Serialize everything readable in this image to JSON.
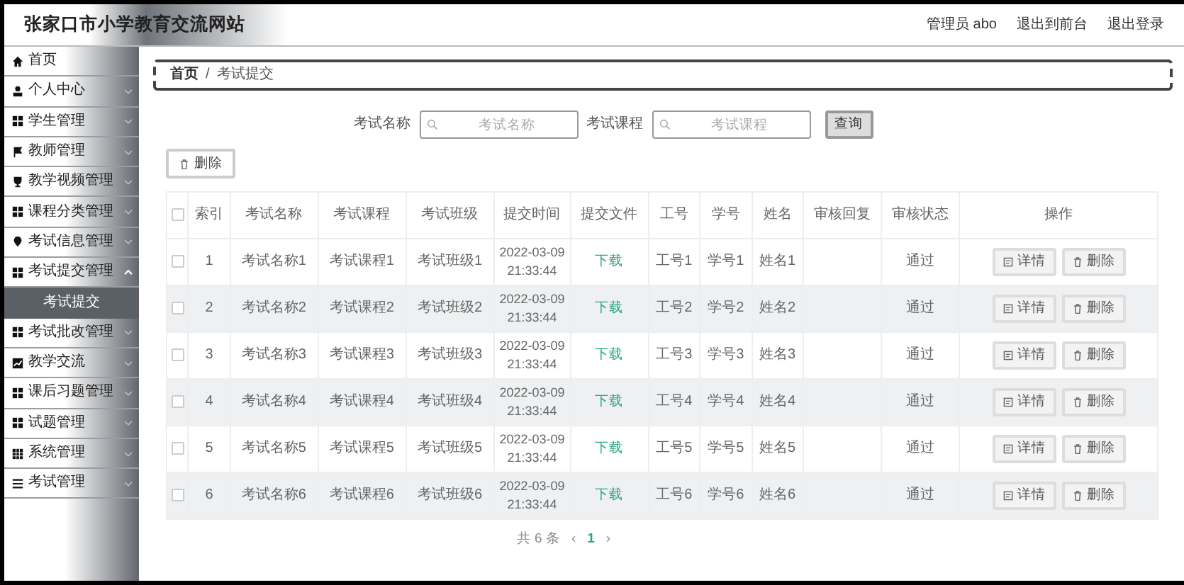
{
  "header": {
    "title": "张家口市小学教育交流网站",
    "user": "管理员 abo",
    "links": [
      "退出到前台",
      "退出登录"
    ]
  },
  "sidebar": {
    "items": [
      {
        "label": "首页",
        "kind": "link"
      },
      {
        "label": "个人中心",
        "kind": "menu",
        "expanded": false
      },
      {
        "label": "学生管理",
        "kind": "menu",
        "expanded": false
      },
      {
        "label": "教师管理",
        "kind": "menu",
        "expanded": false
      },
      {
        "label": "教学视频管理",
        "kind": "menu",
        "expanded": false
      },
      {
        "label": "课程分类管理",
        "kind": "menu",
        "expanded": false
      },
      {
        "label": "考试信息管理",
        "kind": "menu",
        "expanded": false
      },
      {
        "label": "考试提交管理",
        "kind": "menu",
        "expanded": true,
        "children": [
          {
            "label": "考试提交",
            "selected": true
          }
        ]
      },
      {
        "label": "考试批改管理",
        "kind": "menu",
        "expanded": false
      },
      {
        "label": "教学交流",
        "kind": "menu",
        "expanded": false
      },
      {
        "label": "课后习题管理",
        "kind": "menu",
        "expanded": false
      },
      {
        "label": "试题管理",
        "kind": "menu",
        "expanded": false
      },
      {
        "label": "系统管理",
        "kind": "menu",
        "expanded": false
      },
      {
        "label": "考试管理",
        "kind": "menu",
        "expanded": false
      }
    ]
  },
  "breadcrumb": {
    "items": [
      "首页",
      "考试提交"
    ],
    "separator": "/"
  },
  "search": {
    "fields": [
      {
        "label": "考试名称",
        "placeholder": "考试名称"
      },
      {
        "label": "考试课程",
        "placeholder": "考试课程"
      }
    ],
    "button": "查询"
  },
  "delete_button": "删除",
  "table": {
    "select_all": {
      "checked": false
    },
    "columns": [
      "索引",
      "考试名称",
      "考试课程",
      "考试班级",
      "提交时间",
      "提交文件",
      "工号",
      "学号",
      "姓名",
      "审核回复",
      "审核状态",
      "操作"
    ],
    "rows": [
      {
        "checked": false,
        "index": "1",
        "name": "考试名称1",
        "course": "考试课程1",
        "class": "考试班级1",
        "time": "2022-03-09 21:33:44",
        "file": "下载",
        "staff_no": "工号1",
        "student_no": "学号1",
        "student": "姓名1",
        "status": "通过",
        "actions": [
          "详情",
          "删除"
        ]
      },
      {
        "checked": false,
        "index": "2",
        "name": "考试名称2",
        "course": "考试课程2",
        "class": "考试班级2",
        "time": "2022-03-09 21:33:44",
        "file": "下载",
        "staff_no": "工号2",
        "student_no": "学号2",
        "student": "姓名2",
        "status": "通过",
        "actions": [
          "详情",
          "删除"
        ]
      },
      {
        "checked": false,
        "index": "3",
        "name": "考试名称3",
        "course": "考试课程3",
        "class": "考试班级3",
        "time": "2022-03-09 21:33:44",
        "file": "下载",
        "staff_no": "工号3",
        "student_no": "学号3",
        "student": "姓名3",
        "status": "通过",
        "actions": [
          "详情",
          "删除"
        ]
      },
      {
        "checked": false,
        "index": "4",
        "name": "考试名称4",
        "course": "考试课程4",
        "class": "考试班级4",
        "time": "2022-03-09 21:33:44",
        "file": "下载",
        "staff_no": "工号4",
        "student_no": "学号4",
        "student": "姓名4",
        "status": "通过",
        "actions": [
          "详情",
          "删除"
        ]
      },
      {
        "checked": false,
        "index": "5",
        "name": "考试名称5",
        "course": "考试课程5",
        "class": "考试班级5",
        "time": "2022-03-09 21:33:44",
        "file": "下载",
        "staff_no": "工号5",
        "student_no": "学号5",
        "student": "姓名5",
        "status": "通过",
        "actions": [
          "详情",
          "删除"
        ]
      },
      {
        "checked": false,
        "index": "6",
        "name": "考试名称6",
        "course": "考试课程6",
        "class": "考试班级6",
        "time": "2022-03-09 21:33:44",
        "file": "下载",
        "staff_no": "工号6",
        "student_no": "学号6",
        "student": "姓名6",
        "status": "通过",
        "actions": [
          "详情",
          "删除"
        ]
      }
    ]
  },
  "pagination": {
    "total": "共 6 条",
    "prev": "‹",
    "pages": [
      {
        "label": "1",
        "selected": true
      }
    ],
    "next": "›"
  }
}
